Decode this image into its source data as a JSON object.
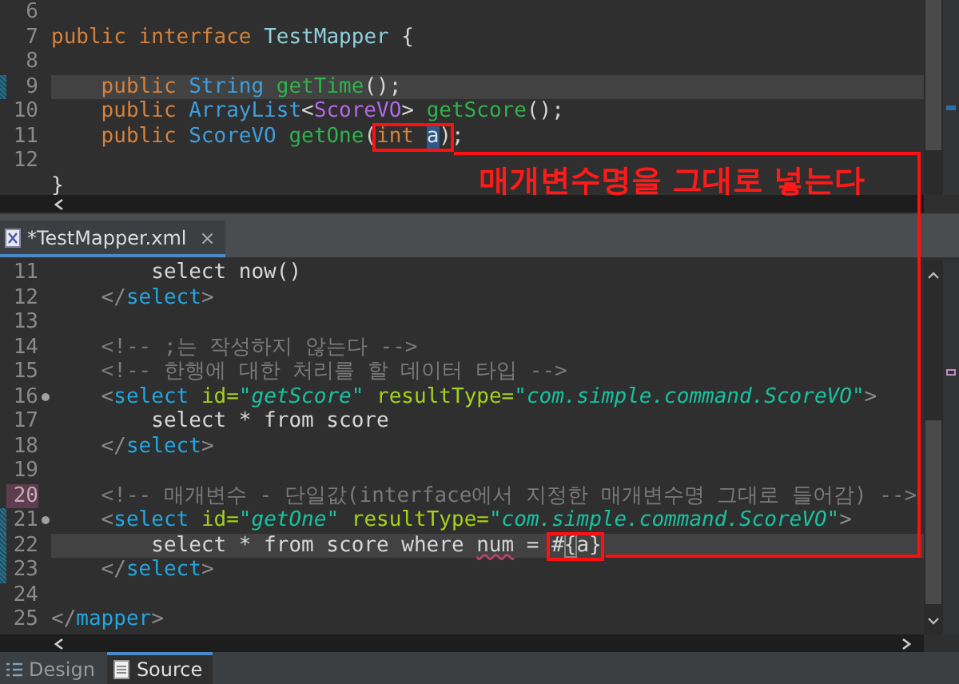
{
  "top_editor": {
    "lines": [
      {
        "number": "6",
        "current": false,
        "changed": false,
        "folding": false,
        "flagged": false
      },
      {
        "number": "7",
        "current": false,
        "changed": false,
        "folding": false,
        "flagged": false,
        "tokens": [
          {
            "kind": "kw",
            "text": "public "
          },
          {
            "kind": "kw",
            "text": "interface "
          },
          {
            "kind": "class",
            "text": "TestMapper"
          },
          {
            "kind": "plain",
            "text": " {"
          }
        ]
      },
      {
        "number": "8",
        "current": false,
        "changed": false,
        "folding": false,
        "flagged": false
      },
      {
        "number": "9",
        "current": true,
        "changed": true,
        "folding": false,
        "flagged": false,
        "tokens": [
          {
            "kind": "kw",
            "text": "    public "
          },
          {
            "kind": "type",
            "text": "String "
          },
          {
            "kind": "method",
            "text": "getTime"
          },
          {
            "kind": "plain",
            "text": "();"
          }
        ]
      },
      {
        "number": "10",
        "current": false,
        "changed": false,
        "folding": false,
        "flagged": false,
        "tokens": [
          {
            "kind": "kw",
            "text": "    public "
          },
          {
            "kind": "type",
            "text": "ArrayList"
          },
          {
            "kind": "plain",
            "text": "<"
          },
          {
            "kind": "generic",
            "text": "ScoreVO"
          },
          {
            "kind": "plain",
            "text": "> "
          },
          {
            "kind": "method",
            "text": "getScore"
          },
          {
            "kind": "plain",
            "text": "();"
          }
        ]
      },
      {
        "number": "11",
        "current": false,
        "changed": false,
        "folding": false,
        "flagged": false,
        "tokens": [
          {
            "kind": "kw",
            "text": "    public "
          },
          {
            "kind": "type",
            "text": "ScoreVO "
          },
          {
            "kind": "method",
            "text": "getOne"
          },
          {
            "kind": "plain",
            "text": "("
          },
          {
            "kind": "box",
            "parts": [
              {
                "kind": "kw",
                "text": "int "
              },
              {
                "kind": "occurrence",
                "text": "a"
              },
              {
                "kind": "plain",
                "text": ")"
              }
            ]
          },
          {
            "kind": "plain",
            "text": ";"
          }
        ]
      },
      {
        "number": "12",
        "current": false,
        "changed": false,
        "folding": false,
        "flagged": false
      },
      {
        "current": false,
        "changed": false,
        "folding": false,
        "flagged": false,
        "tokens": [
          {
            "kind": "plain",
            "text": "}"
          }
        ]
      }
    ]
  },
  "callout": {
    "text": "매개변수명을 그대로 넣는다"
  },
  "editor_tab": {
    "label": "*TestMapper.xml",
    "close": "×"
  },
  "bottom_editor": {
    "lines": [
      {
        "number": "11",
        "current": false,
        "changed": false,
        "folding": false,
        "flagged": false,
        "tokens": [
          {
            "kind": "plain",
            "text": "        select now()"
          }
        ]
      },
      {
        "number": "12",
        "current": false,
        "changed": false,
        "folding": false,
        "flagged": false,
        "tokens": [
          {
            "kind": "bracket",
            "text": "    </"
          },
          {
            "kind": "tag",
            "text": "select"
          },
          {
            "kind": "bracket",
            "text": ">"
          }
        ]
      },
      {
        "number": "13",
        "current": false,
        "changed": false,
        "folding": false,
        "flagged": false
      },
      {
        "number": "14",
        "current": false,
        "changed": false,
        "folding": false,
        "flagged": false,
        "tokens": [
          {
            "kind": "comment",
            "text": "    <!-- ;는 작성하지 않는다 -->"
          }
        ]
      },
      {
        "number": "15",
        "current": false,
        "changed": false,
        "folding": false,
        "flagged": false,
        "tokens": [
          {
            "kind": "comment",
            "text": "    <!-- 한행에 대한 처리를 할 데이터 타입 -->"
          }
        ]
      },
      {
        "number": "16",
        "current": false,
        "changed": false,
        "folding": true,
        "flagged": false,
        "tokens": [
          {
            "kind": "bracket",
            "text": "    <"
          },
          {
            "kind": "tag",
            "text": "select "
          },
          {
            "kind": "attr",
            "text": "id="
          },
          {
            "kind": "string",
            "text": "\"getScore\""
          },
          {
            "kind": "attr",
            "text": " resultType="
          },
          {
            "kind": "string",
            "text": "\"com.simple.command.ScoreVO\""
          },
          {
            "kind": "bracket",
            "text": ">"
          }
        ]
      },
      {
        "number": "17",
        "current": false,
        "changed": false,
        "folding": false,
        "flagged": false,
        "tokens": [
          {
            "kind": "plain",
            "text": "        select * from score"
          }
        ]
      },
      {
        "number": "18",
        "current": false,
        "changed": false,
        "folding": false,
        "flagged": false,
        "tokens": [
          {
            "kind": "bracket",
            "text": "    </"
          },
          {
            "kind": "tag",
            "text": "select"
          },
          {
            "kind": "bracket",
            "text": ">"
          }
        ]
      },
      {
        "number": "19",
        "current": false,
        "changed": false,
        "folding": false,
        "flagged": false
      },
      {
        "number": "20",
        "current": false,
        "changed": false,
        "folding": false,
        "flagged": true,
        "tokens": [
          {
            "kind": "comment",
            "text": "    <!-- 매개변수 - 단일값(interface에서 지정한 매개변수명 그대로 들어감) -->"
          }
        ]
      },
      {
        "number": "21",
        "current": false,
        "changed": true,
        "folding": true,
        "flagged": false,
        "tokens": [
          {
            "kind": "bracket",
            "text": "    <"
          },
          {
            "kind": "tag",
            "text": "select "
          },
          {
            "kind": "attr",
            "text": "id="
          },
          {
            "kind": "string",
            "text": "\"getOne\""
          },
          {
            "kind": "attr",
            "text": " resultType="
          },
          {
            "kind": "string",
            "text": "\"com.simple.command.ScoreVO\""
          },
          {
            "kind": "bracket",
            "text": ">"
          }
        ]
      },
      {
        "number": "22",
        "current": true,
        "changed": true,
        "folding": false,
        "flagged": false,
        "tokens": [
          {
            "kind": "plain",
            "text": "        select * from score where "
          },
          {
            "kind": "warn",
            "text": "num"
          },
          {
            "kind": "plain",
            "text": " = "
          },
          {
            "kind": "box",
            "parts": [
              {
                "kind": "plain",
                "text": "#"
              },
              {
                "kind": "match",
                "text": "{"
              },
              {
                "kind": "plain",
                "text": "a}"
              }
            ]
          }
        ]
      },
      {
        "number": "23",
        "current": false,
        "changed": true,
        "folding": false,
        "flagged": false,
        "tokens": [
          {
            "kind": "bracket",
            "text": "    </"
          },
          {
            "kind": "tag",
            "text": "select"
          },
          {
            "kind": "bracket",
            "text": ">"
          }
        ]
      },
      {
        "number": "24",
        "current": false,
        "changed": false,
        "folding": false,
        "flagged": false
      },
      {
        "number": "25",
        "current": false,
        "changed": false,
        "folding": false,
        "flagged": false,
        "tokens": [
          {
            "kind": "bracket",
            "text": "</"
          },
          {
            "kind": "tag",
            "text": "mapper"
          },
          {
            "kind": "bracket",
            "text": ">"
          }
        ]
      }
    ]
  },
  "bottom_tabs": [
    {
      "label": "Design",
      "selected": false
    },
    {
      "label": "Source",
      "selected": true
    }
  ]
}
